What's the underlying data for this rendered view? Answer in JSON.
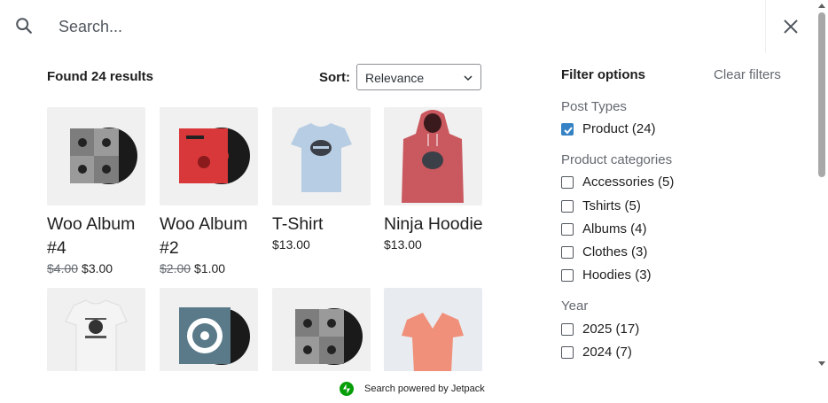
{
  "search": {
    "placeholder": "Search..."
  },
  "results": {
    "count_label": "Found 24 results",
    "sort_label": "Sort:",
    "sort_value": "Relevance"
  },
  "products": [
    {
      "title": "Woo Album #4",
      "old_price": "$4.00",
      "price": "$3.00",
      "image": "album-grey-vinyl"
    },
    {
      "title": "Woo Album #2",
      "old_price": "$2.00",
      "price": "$1.00",
      "image": "album-red-vinyl"
    },
    {
      "title": "T-Shirt",
      "old_price": "",
      "price": "$13.00",
      "image": "tshirt-light-blue"
    },
    {
      "title": "Ninja Hoodie",
      "old_price": "",
      "price": "$13.00",
      "image": "hoodie-red"
    },
    {
      "title": "",
      "old_price": "",
      "price": "",
      "image": "tshirt-white"
    },
    {
      "title": "",
      "old_price": "",
      "price": "",
      "image": "album-blue-vinyl"
    },
    {
      "title": "",
      "old_price": "",
      "price": "",
      "image": "album-grey-vinyl"
    },
    {
      "title": "",
      "old_price": "",
      "price": "",
      "image": "vneck-peach"
    }
  ],
  "filters": {
    "title": "Filter options",
    "clear_label": "Clear filters",
    "groups": [
      {
        "title": "Post Types",
        "items": [
          {
            "label": "Product (24)",
            "checked": true
          }
        ]
      },
      {
        "title": "Product categories",
        "items": [
          {
            "label": "Accessories (5)",
            "checked": false
          },
          {
            "label": "Tshirts (5)",
            "checked": false
          },
          {
            "label": "Albums (4)",
            "checked": false
          },
          {
            "label": "Clothes (3)",
            "checked": false
          },
          {
            "label": "Hoodies (3)",
            "checked": false
          }
        ]
      },
      {
        "title": "Year",
        "items": [
          {
            "label": "2025 (17)",
            "checked": false
          },
          {
            "label": "2024 (7)",
            "checked": false
          }
        ]
      }
    ]
  },
  "footer": {
    "powered_by": "Search powered by Jetpack"
  },
  "colors": {
    "accent": "#3582c4",
    "jetpack": "#069e08",
    "muted": "#646970"
  }
}
